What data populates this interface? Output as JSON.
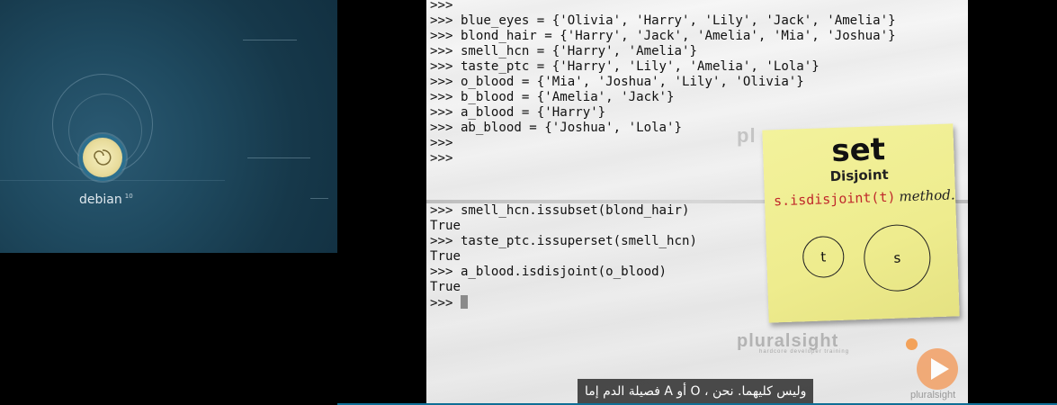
{
  "desktop": {
    "logo_label": "debian",
    "logo_version": "10"
  },
  "terminal_top": {
    "lines": [
      ">>>",
      ">>> blue_eyes = {'Olivia', 'Harry', 'Lily', 'Jack', 'Amelia'}",
      ">>> blond_hair = {'Harry', 'Jack', 'Amelia', 'Mia', 'Joshua'}",
      ">>> smell_hcn = {'Harry', 'Amelia'}",
      ">>> taste_ptc = {'Harry', 'Lily', 'Amelia', 'Lola'}",
      ">>> o_blood = {'Mia', 'Joshua', 'Lily', 'Olivia'}",
      ">>> b_blood = {'Amelia', 'Jack'}",
      ">>> a_blood = {'Harry'}",
      ">>> ab_blood = {'Joshua', 'Lola'}",
      ">>>",
      ">>>"
    ]
  },
  "terminal_bottom": {
    "lines": [
      ">>> smell_hcn.issubset(blond_hair)",
      "True",
      ">>> taste_ptc.issuperset(smell_hcn)",
      "True",
      ">>> a_blood.isdisjoint(o_blood)",
      "True"
    ],
    "prompt": ">>> "
  },
  "note": {
    "title": "set",
    "subtitle": "Disjoint",
    "method_code": "s.isdisjoint(t)",
    "method_word": "method.",
    "circle_t": "t",
    "circle_s": "s"
  },
  "watermark": {
    "top": "pl",
    "brand": "pluralsight",
    "tagline": "hardcore developer training",
    "logo_text": "pluralsight"
  },
  "subtitle": "وليس كليهما. نحن ، O أو A فصيلة الدم إما",
  "colors": {
    "method_code": "#c0282b",
    "note_bg": "#eeec8e",
    "brand_orange": "#f2a46c",
    "progress": "#0f6f96"
  }
}
